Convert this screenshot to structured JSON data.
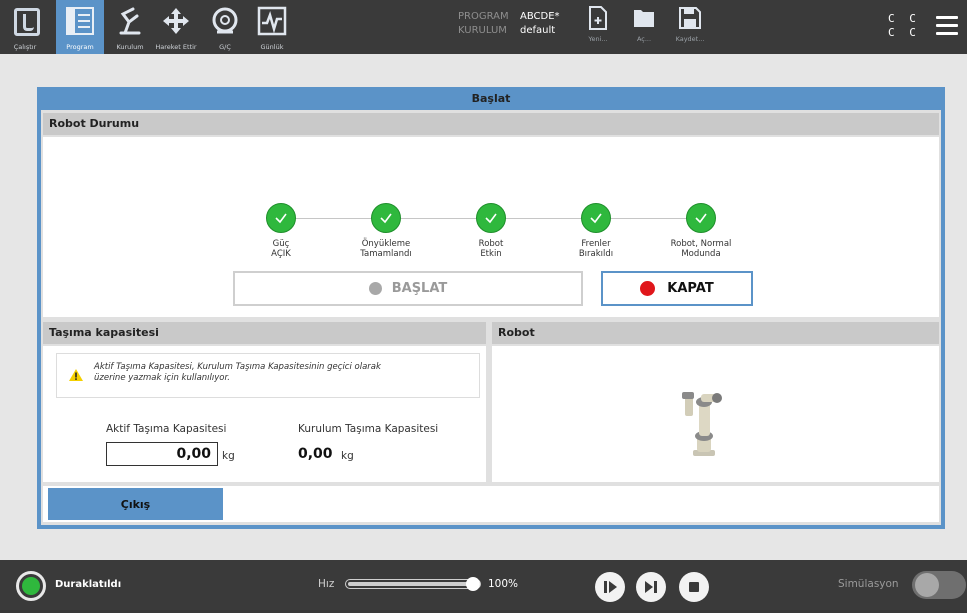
{
  "nav": {
    "items": [
      {
        "label": "Çalıştır",
        "icon": "ur-logo-icon"
      },
      {
        "label": "Program",
        "icon": "program-icon",
        "active": true
      },
      {
        "label": "Kurulum",
        "icon": "robot-arm-icon"
      },
      {
        "label": "Hareket Ettir",
        "icon": "move-arrows-icon"
      },
      {
        "label": "G/Ç",
        "icon": "io-gauge-icon"
      },
      {
        "label": "Günlük",
        "icon": "log-chart-icon"
      }
    ]
  },
  "program": {
    "program_key": "PROGRAM",
    "program_value": "ABCDE*",
    "install_key": "KURULUM",
    "install_value": "default"
  },
  "toolbar": {
    "new_label": "Yeni...",
    "open_label": "Aç...",
    "save_label": "Kaydet..."
  },
  "header_right": {
    "cc_top": "C C",
    "cc_bottom": "C C"
  },
  "dialog": {
    "title": "Başlat",
    "robot_status": {
      "header": "Robot Durumu",
      "steps": [
        {
          "line1": "Güç",
          "line2": "AÇIK"
        },
        {
          "line1": "Önyükleme",
          "line2": "Tamamlandı"
        },
        {
          "line1": "Robot",
          "line2": "Etkin"
        },
        {
          "line1": "Frenler",
          "line2": "Bırakıldı"
        },
        {
          "line1": "Robot, Normal",
          "line2": "Modunda"
        }
      ],
      "start_label": "BAŞLAT",
      "stop_label": "KAPAT"
    },
    "payload": {
      "header": "Taşıma kapasitesi",
      "warning_line1": "Aktif Taşıma Kapasitesi, Kurulum Taşıma Kapasitesinin geçici olarak",
      "warning_line2": "üzerine yazmak için kullanılıyor.",
      "active_label": "Aktif Taşıma Kapasitesi",
      "active_value": "0,00",
      "active_unit": "kg",
      "install_label": "Kurulum Taşıma Kapasitesi",
      "install_value": "0,00",
      "install_unit": "kg"
    },
    "robot_panel": {
      "header": "Robot"
    },
    "exit_label": "Çıkış"
  },
  "footer": {
    "status": "Duraklatıldı",
    "speed_label": "Hız",
    "speed_value": "100%",
    "speed_fraction": 1.0,
    "simulation_label": "Simülasyon"
  },
  "colors": {
    "accent": "#5b93c8",
    "ok": "#2fb83d",
    "stop": "#e0161b",
    "bar": "#3a3a3a"
  }
}
